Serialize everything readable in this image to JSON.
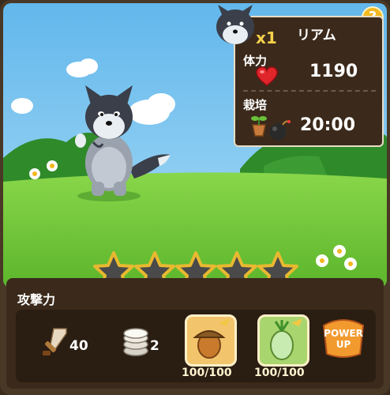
{
  "help": {
    "label": "?"
  },
  "pet": {
    "name": "リアム",
    "multiplier": "x1"
  },
  "stats": {
    "hp_label": "体力",
    "hp_value": "1190",
    "grow_label": "栽培",
    "grow_timer": "20:00"
  },
  "stars": {
    "filled": 0,
    "total": 5
  },
  "attack": {
    "label": "攻撃力",
    "sword_value": "40",
    "coin_value": "2",
    "acorn_count": "100/100",
    "veg_count": "100/100",
    "power_up": [
      "POWER",
      "UP"
    ]
  },
  "colors": {
    "sky": "#7fc8ef",
    "grass": "#7ccf3e",
    "panel": "#3b2a1b",
    "accent": "#f2b81e"
  },
  "icons": [
    "help-icon",
    "wolf-avatar-icon",
    "heart-icon",
    "plant-pot-icon",
    "bomb-icon",
    "star-icon",
    "sword-icon",
    "coin-stack-icon",
    "acorn-icon",
    "vegetable-icon",
    "power-up-icon"
  ]
}
